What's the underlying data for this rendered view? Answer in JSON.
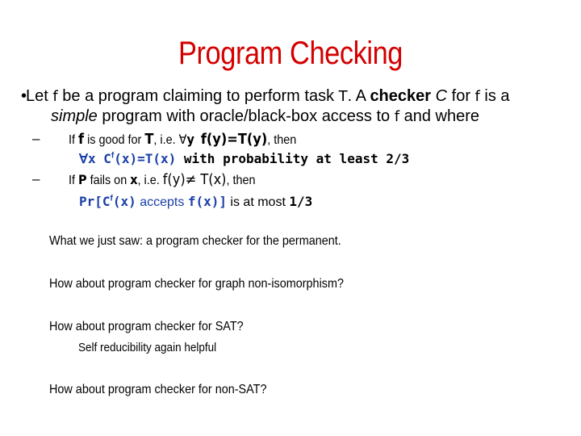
{
  "title": "Program Checking",
  "bullet": {
    "symbol": "•",
    "line1": {
      "let": "Let ",
      "f1": "f",
      "t1": " be a program claiming to perform task ",
      "T": "T",
      "t2": ". A ",
      "checker": "checker",
      "C": "C",
      "t3": " for ",
      "f2": "f",
      "t4": " is a"
    },
    "line2": {
      "simple": "simple",
      "t1": " program with oracle/black-box access to ",
      "f": "f",
      "t2": " and where"
    }
  },
  "sub_items": [
    {
      "dash": "–",
      "line": {
        "if": "If ",
        "f": "f",
        "t1": " is good for ",
        "T": "T",
        "t2": ", i.e. ",
        "forall": "∀",
        "y": "y",
        "eq": "f(y)=T(y)",
        "t3": ", then"
      },
      "follow": {
        "forall": "∀",
        "expr_pre": "x C",
        "sup": "f",
        "expr_post": "(x)=T(x)",
        "rest": " with probability at least 2/3"
      }
    },
    {
      "dash": "–",
      "line": {
        "if": "If ",
        "P": "P",
        "t1": " fails on ",
        "x": "x",
        "t2": ", i.e. ",
        "eq": "f(y)≠ T(x)",
        "t3": ", then"
      },
      "follow": {
        "pre": "Pr[C",
        "sup": "f",
        "mid": "(x)",
        "accepts": " accepts ",
        "fx": "f(x)]",
        "rest": " is at most ",
        "val": "1/3"
      }
    }
  ],
  "paragraphs": {
    "p1": "What we just saw: a program checker for the permanent.",
    "p2": "How about program checker for graph non-isomorphism?",
    "p3": "How about program checker for SAT?",
    "p3_sub": "Self reducibility again helpful",
    "p4": "How about program checker for non-SAT?"
  },
  "colors": {
    "title": "#d40000",
    "math_blue": "#1a3fa8",
    "text": "#000000"
  }
}
